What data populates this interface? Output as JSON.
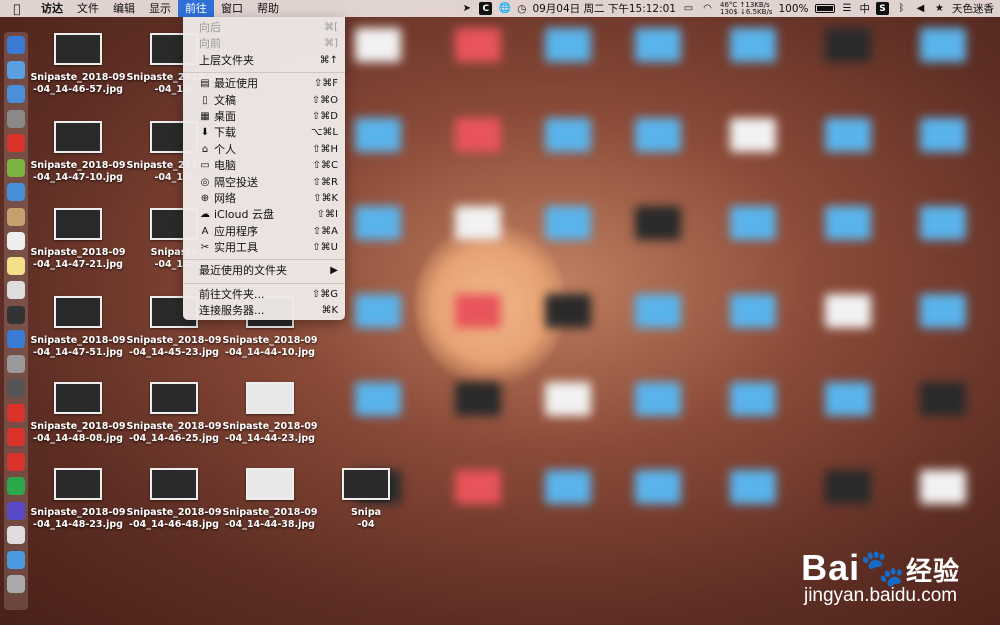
{
  "menubar": {
    "finder": "访达",
    "file": "文件",
    "edit": "编辑",
    "view": "显示",
    "go": "前往",
    "window": "窗口",
    "help": "帮助"
  },
  "status": {
    "c_icon": "C",
    "datetime": "09月04日 周二 下午15:12:01",
    "temp": "46°C",
    "upload": "↑13KB/s",
    "cpu": "130$",
    "download": "↓6.5KB/s",
    "battery": "100%",
    "input_method": "中",
    "s_icon": "S",
    "user": "天色迷香"
  },
  "go_menu": {
    "back": {
      "label": "向后",
      "shortcut": "⌘["
    },
    "forward": {
      "label": "向前",
      "shortcut": "⌘]"
    },
    "enclosing": {
      "label": "上层文件夹",
      "shortcut": "⌘↑"
    },
    "recents": {
      "label": "最近使用",
      "shortcut": "⇧⌘F"
    },
    "documents": {
      "label": "文稿",
      "shortcut": "⇧⌘O"
    },
    "desktop": {
      "label": "桌面",
      "shortcut": "⇧⌘D"
    },
    "downloads": {
      "label": "下载",
      "shortcut": "⌥⌘L"
    },
    "home": {
      "label": "个人",
      "shortcut": "⇧⌘H"
    },
    "computer": {
      "label": "电脑",
      "shortcut": "⇧⌘C"
    },
    "airdrop": {
      "label": "隔空投送",
      "shortcut": "⇧⌘R"
    },
    "network": {
      "label": "网络",
      "shortcut": "⇧⌘K"
    },
    "icloud": {
      "label": "iCloud 云盘",
      "shortcut": "⇧⌘I"
    },
    "applications": {
      "label": "应用程序",
      "shortcut": "⇧⌘A"
    },
    "utilities": {
      "label": "实用工具",
      "shortcut": "⇧⌘U"
    },
    "recent_folders": {
      "label": "最近使用的文件夹",
      "arrow": "▶"
    },
    "goto_folder": {
      "label": "前往文件夹...",
      "shortcut": "⇧⌘G"
    },
    "connect_server": {
      "label": "连接服务器...",
      "shortcut": "⌘K"
    }
  },
  "desktop_files": [
    {
      "line1": "Snipaste_2018-09",
      "line2": "-04_14-46-57.jpg"
    },
    {
      "line1": "Snipaste_2018-09",
      "line2": "-04_14-47-10.jpg"
    },
    {
      "line1": "Snipaste_2018-09",
      "line2": "-04_14-47-21.jpg"
    },
    {
      "line1": "Snipaste_2018-09",
      "line2": "-04_14-47-51.jpg"
    },
    {
      "line1": "Snipaste_2018-09",
      "line2": "-04_14-48-08.jpg"
    },
    {
      "line1": "Snipaste_2018-09",
      "line2": "-04_14-48-23.jpg"
    },
    {
      "line1": "Snipaste_2018-09",
      "line2": "-04_14-"
    },
    {
      "line1": "Snipaste_2018-09",
      "line2": "-04_14-"
    },
    {
      "line1": "Snipaste",
      "line2": "-04_14-"
    },
    {
      "line1": "Snipaste_2018-09",
      "line2": "-04_14-45-23.jpg"
    },
    {
      "line1": "Snipaste_2018-09",
      "line2": "-04_14-46-25.jpg"
    },
    {
      "line1": "Snipaste_2018-09",
      "line2": "-04_14-46-48.jpg"
    },
    {
      "line1": "Snipaste_2018-09",
      "line2": "-04_14-44-10.jpg"
    },
    {
      "line1": "Snipaste_2018-09",
      "line2": "-04_14-44-23.jpg"
    },
    {
      "line1": "Snipaste_2018-09",
      "line2": "-04_14-44-38.jpg"
    },
    {
      "line1": "Snipa",
      "line2": "-04"
    }
  ],
  "watermark": {
    "logo_a": "Bai",
    "logo_b": "经验",
    "url": "jingyan.baidu.com"
  }
}
